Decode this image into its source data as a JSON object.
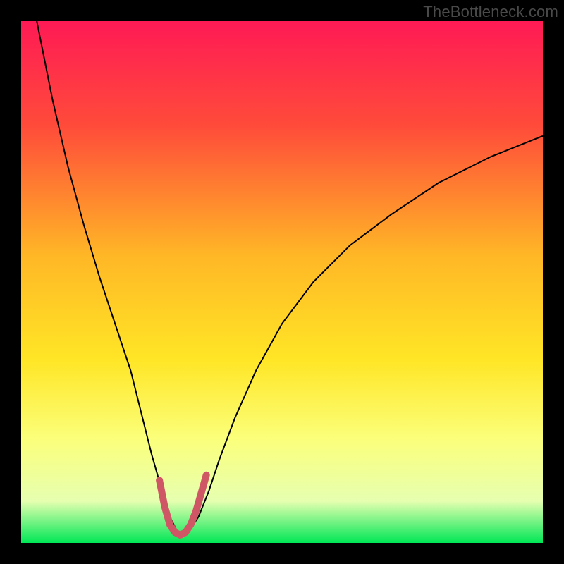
{
  "watermark": "TheBottleneck.com",
  "chart_data": {
    "type": "line",
    "title": "",
    "xlabel": "",
    "ylabel": "",
    "xlim": [
      0,
      100
    ],
    "ylim": [
      0,
      100
    ],
    "background_gradient": {
      "stops": [
        {
          "offset": 0,
          "color": "#ff1a55"
        },
        {
          "offset": 20,
          "color": "#ff4b3a"
        },
        {
          "offset": 45,
          "color": "#ffb726"
        },
        {
          "offset": 65,
          "color": "#ffe626"
        },
        {
          "offset": 80,
          "color": "#fbff7a"
        },
        {
          "offset": 92,
          "color": "#e6ffb0"
        },
        {
          "offset": 100,
          "color": "#00e756"
        }
      ]
    },
    "series": [
      {
        "name": "bottleneck-curve",
        "stroke": "#000000",
        "stroke_width": 2,
        "x": [
          3,
          6,
          9,
          12,
          15,
          18,
          21,
          23,
          25,
          27,
          28.5,
          30,
          31,
          32,
          34,
          36,
          38,
          41,
          45,
          50,
          56,
          63,
          71,
          80,
          90,
          100
        ],
        "y": [
          100,
          85,
          72,
          61,
          51,
          42,
          33,
          25,
          17,
          10,
          5,
          2,
          1.5,
          2,
          5,
          10,
          16,
          24,
          33,
          42,
          50,
          57,
          63,
          69,
          74,
          78
        ]
      },
      {
        "name": "optimal-mark",
        "stroke": "#cf5765",
        "stroke_width": 10,
        "linecap": "round",
        "x": [
          26.5,
          27.5,
          28.5,
          29.5,
          30.5,
          31.5,
          32.5,
          33.5,
          34.5,
          35.5
        ],
        "y": [
          12,
          7,
          3.5,
          2,
          1.5,
          2,
          3.5,
          6,
          9.5,
          13
        ]
      }
    ]
  }
}
